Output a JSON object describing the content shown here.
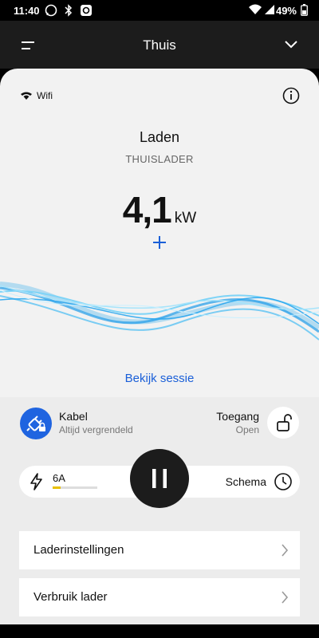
{
  "statusbar": {
    "time": "11:40",
    "battery": "49%"
  },
  "appbar": {
    "title": "Thuis"
  },
  "connection": {
    "label": "Wifi"
  },
  "charger": {
    "status": "Laden",
    "name": "THUISLADER",
    "power_value": "4,1",
    "power_unit": "kW"
  },
  "session_link": "Bekijk sessie",
  "cable": {
    "title": "Kabel",
    "subtitle": "Altijd vergrendeld"
  },
  "access": {
    "title": "Toegang",
    "subtitle": "Open"
  },
  "current": {
    "label": "6A",
    "level": 0.18
  },
  "schedule": {
    "label": "Schema"
  },
  "menu": [
    {
      "label": "Laderinstellingen"
    },
    {
      "label": "Verbruik lader"
    }
  ],
  "colors": {
    "accent": "#1f64e0",
    "link": "#1a5fd8",
    "amp_fill": "#e8c000",
    "dark": "#1c1c1c"
  },
  "icons": [
    "whatsapp-icon",
    "bluetooth-icon",
    "app-icon",
    "wifi-icon",
    "signal-icon",
    "battery-icon",
    "menu-icon",
    "chevron-down-icon",
    "info-icon",
    "plus-icon",
    "cable-plug-icon",
    "unlock-icon",
    "bolt-icon",
    "clock-icon",
    "pause-icon",
    "chevron-right-icon"
  ]
}
